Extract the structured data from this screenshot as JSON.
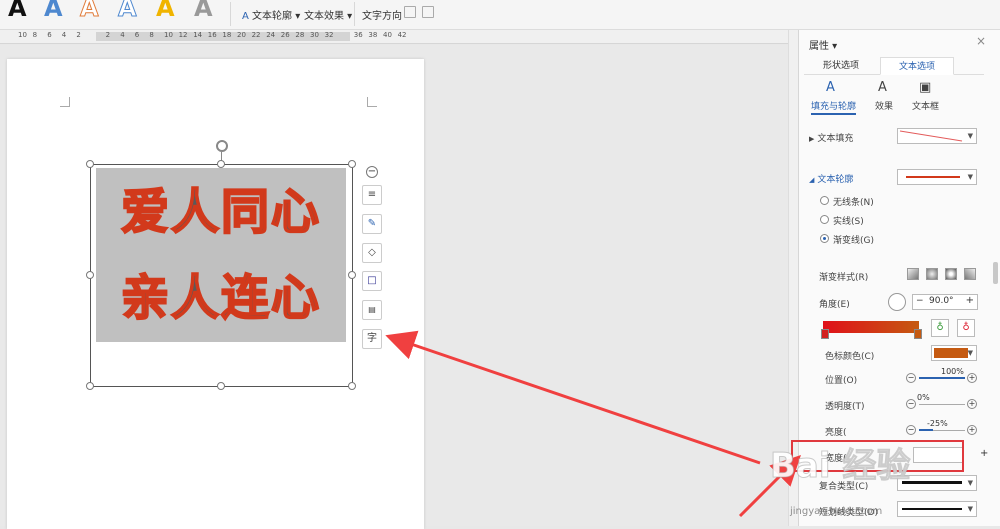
{
  "ribbon": {
    "style_letter": "A",
    "text_outline": "文本轮廓",
    "text_effect": "文本效果",
    "text_direction": "文字方向"
  },
  "ruler": {
    "ticks": [
      "10",
      "8",
      "6",
      "4",
      "2",
      "",
      "2",
      "4",
      "6",
      "8",
      "10",
      "12",
      "14",
      "16",
      "18",
      "20",
      "22",
      "24",
      "26",
      "28",
      "30",
      "32",
      "",
      "36",
      "38",
      "40",
      "42"
    ]
  },
  "document": {
    "line1": "爱人同心",
    "line2": "亲人连心"
  },
  "side_tools": {
    "text_tool": "字"
  },
  "panel": {
    "title": "属性 ▾",
    "close": "×",
    "tabs": [
      "形状选项",
      "文本选项"
    ],
    "subtabs": [
      "填充与轮廓",
      "效果",
      "文本框"
    ],
    "text_fill": "文本填充",
    "text_outline": "文本轮廓",
    "radios": [
      "无线条(N)",
      "实线(S)",
      "渐变线(G)"
    ],
    "gradient_style": "渐变样式(R)",
    "angle": "角度(E)",
    "angle_value": "90.0°",
    "stop_color": "色标颜色(C)",
    "position": "位置(O)",
    "position_value": "100%",
    "position_pct": 100,
    "transparency": "透明度(T)",
    "transparency_value": "0%",
    "transparency_pct": 0,
    "brightness": "亮度(",
    "brightness_value": "-25%",
    "width": "宽度(",
    "compound": "复合类型(C)",
    "dash": "短划线类型(D)",
    "colors": {
      "accent": "#2b62b0",
      "stop_color": "#c55a11",
      "outline": "#d2391b"
    }
  },
  "watermark": {
    "main": "Bai 经验",
    "sub": "jingyan.baidu.com"
  }
}
